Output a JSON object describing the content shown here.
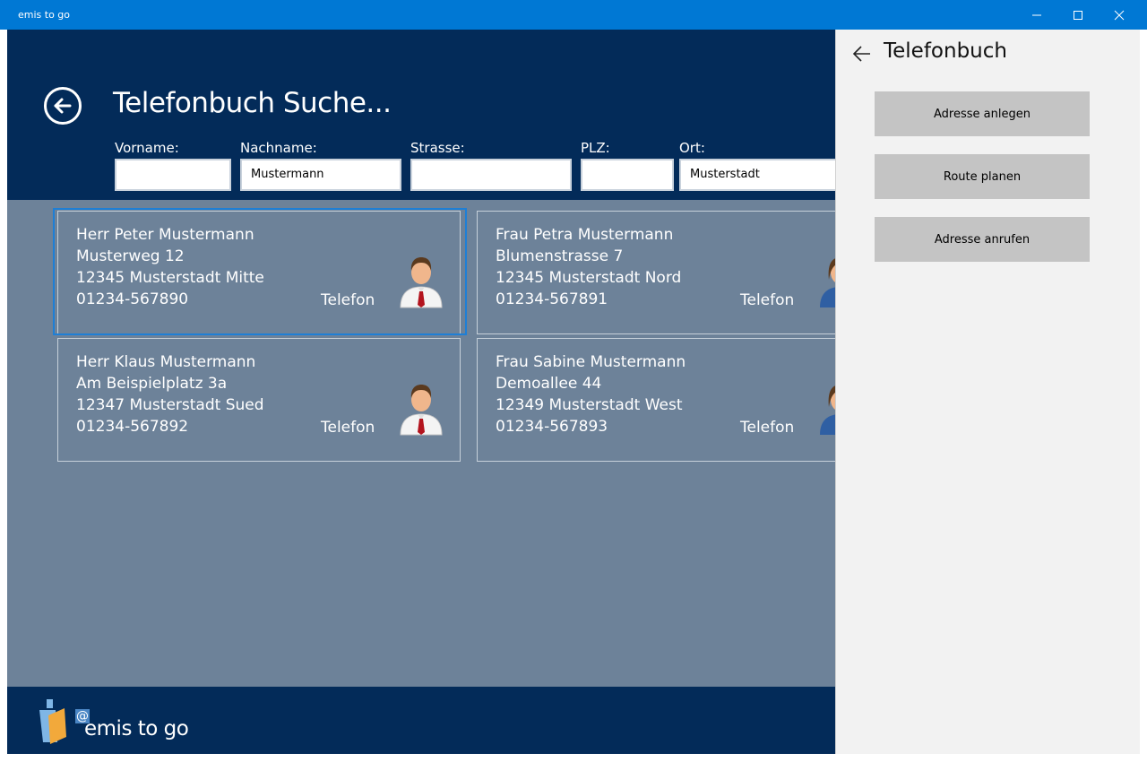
{
  "window": {
    "title": "emis to go",
    "controls": [
      "minimize-icon",
      "maximize-icon",
      "close-icon"
    ]
  },
  "header": {
    "title": "Telefonbuch Suche...",
    "back_icon": "arrow-left-circle-icon"
  },
  "search": {
    "fields": [
      {
        "label": "Vorname:",
        "value": ""
      },
      {
        "label": "Nachname:",
        "value": "Mustermann"
      },
      {
        "label": "Strasse:",
        "value": ""
      },
      {
        "label": "PLZ:",
        "value": ""
      },
      {
        "label": "Ort:",
        "value": "Musterstadt"
      }
    ]
  },
  "results": [
    {
      "name": "Herr Peter Mustermann",
      "street": "Musterweg 12",
      "city": "12345 Musterstadt Mitte",
      "phone": "01234-567890",
      "phone_label": "Telefon",
      "avatar": "male-person-icon",
      "selected": true
    },
    {
      "name": "Frau Petra Mustermann",
      "street": "Blumenstrasse 7",
      "city": "12345 Musterstadt Nord",
      "phone": "01234-567891",
      "phone_label": "Telefon",
      "avatar": "female-person-icon",
      "selected": false
    },
    {
      "name": "Herr Klaus Mustermann",
      "street": "Am Beispielplatz 3a",
      "city": "12347 Musterstadt Sued",
      "phone": "01234-567892",
      "phone_label": "Telefon",
      "avatar": "male-person-icon",
      "selected": false
    },
    {
      "name": "Frau Sabine Mustermann",
      "street": "Demoallee 44",
      "city": "12349 Musterstadt West",
      "phone": "01234-567893",
      "phone_label": "Telefon",
      "avatar": "female-person-icon",
      "selected": false
    }
  ],
  "footer": {
    "logo_at": "@",
    "logo_text": "emis to go"
  },
  "flyout": {
    "title": "Telefonbuch",
    "buttons": [
      "Adresse anlegen",
      "Route planen",
      "Adresse anrufen"
    ]
  },
  "colors": {
    "titlebar": "#0078d4",
    "header": "#032b59",
    "content": "#6d8299",
    "flyout": "#f2f2f2",
    "button": "#c4c4c4",
    "selection": "#1e7fd6"
  }
}
